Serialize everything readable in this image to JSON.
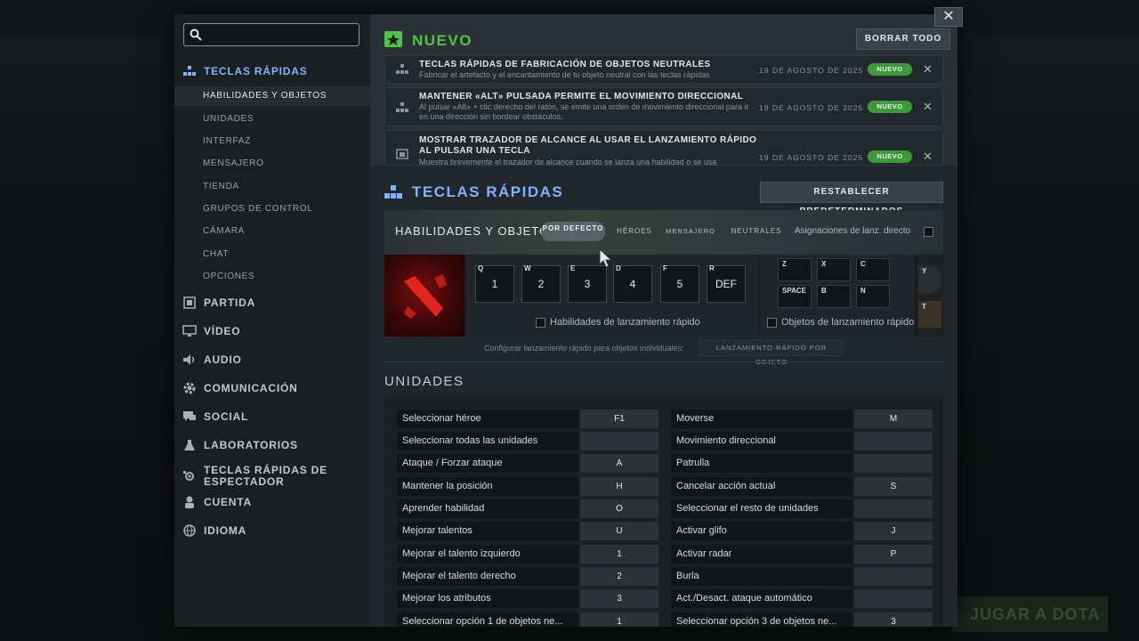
{
  "background": {
    "play_button": "JUGAR A DOTA"
  },
  "sidebar": {
    "search_placeholder": "",
    "categories": [
      {
        "label": "Teclas rápidas",
        "icon": "hotkeys-icon",
        "active": true
      },
      {
        "label": "Partida",
        "icon": "game-icon"
      },
      {
        "label": "Vídeo",
        "icon": "monitor-icon"
      },
      {
        "label": "Audio",
        "icon": "speaker-icon"
      },
      {
        "label": "Comunicación",
        "icon": "gear-icon"
      },
      {
        "label": "Social",
        "icon": "chat-icon"
      },
      {
        "label": "Laboratorios",
        "icon": "flask-icon"
      },
      {
        "label": "Teclas rápidas de espectador",
        "icon": "spectator-icon"
      },
      {
        "label": "Cuenta",
        "icon": "user-icon"
      },
      {
        "label": "Idioma",
        "icon": "globe-icon"
      }
    ],
    "subitems": [
      "Habilidades y objetos",
      "Unidades",
      "Interfaz",
      "Mensajero",
      "Tienda",
      "Grupos de control",
      "Cámara",
      "Chat",
      "Opciones"
    ]
  },
  "new_section": {
    "title": "NUEVO",
    "clear_all": "BORRAR TODO",
    "items": [
      {
        "title": "Teclas rápidas de fabricación de objetos neutrales",
        "desc": "Fabricar el artefacto y el encantamiento de tu objeto neutral con las teclas rápidas",
        "date": "19 de agosto de 2025",
        "badge": "NUEVO"
      },
      {
        "title": "Mantener «Alt» pulsada permite el movimiento direccional",
        "desc": "Al pulsar «Alt» + clic derecho del ratón, se emite una orden de movimiento direccional para ir en una dirección sin bordear obstáculos.",
        "date": "19 de agosto de 2025",
        "badge": "NUEVO"
      },
      {
        "title": "Mostrar trazador de alcance al usar el lanzamiento rápido al pulsar una tecla",
        "desc": "Muestra brevemente el trazador de alcance cuando se lanza una habilidad o se usa",
        "date": "19 de agosto de 2025",
        "badge": "NUEVO"
      }
    ]
  },
  "hotkeys_section": {
    "title": "TECLAS RÁPIDAS",
    "reset_button": "RESTABLECER PREDETERMINADOS",
    "tab_label": "Habilidades y objetos",
    "tabs": [
      "POR DEFECTO",
      "HÉROES",
      "MENSAJERO",
      "NEUTRALES"
    ],
    "direct_cast_label": "Asignaciones de lanz. directo",
    "ability_keys": [
      {
        "key": "Q",
        "value": "1"
      },
      {
        "key": "W",
        "value": "2"
      },
      {
        "key": "E",
        "value": "3"
      },
      {
        "key": "D",
        "value": "4"
      },
      {
        "key": "F",
        "value": "5"
      },
      {
        "key": "R",
        "value": "DEF"
      }
    ],
    "item_keys": [
      "Z",
      "X",
      "C",
      "SPACE",
      "B",
      "N"
    ],
    "extra_keys": [
      "Y",
      "T"
    ],
    "quick_cast_abilities": "Habilidades de lanzamiento rápido",
    "quick_cast_items": "Objetos de lanzamiento rápido",
    "configure_label": "Configurar lanzamiento rápido para objetos individuales:",
    "per_item_button": "LANZAMIENTO RÁPIDO POR OBJETO"
  },
  "units_section": {
    "title": "UNIDADES",
    "left": [
      {
        "label": "Seleccionar héroe",
        "key": "F1"
      },
      {
        "label": "Seleccionar todas las unidades",
        "key": ""
      },
      {
        "label": "Ataque / Forzar ataque",
        "key": "A"
      },
      {
        "label": "Mantener la posición",
        "key": "H"
      },
      {
        "label": "Aprender habilidad",
        "key": "O"
      },
      {
        "label": "Mejorar talentos",
        "key": "U"
      },
      {
        "label": "Mejorar el talento izquierdo",
        "key": "1"
      },
      {
        "label": "Mejorar el talento derecho",
        "key": "2"
      },
      {
        "label": "Mejorar los atributos",
        "key": "3"
      },
      {
        "label": "Seleccionar opción 1 de objetos ne...",
        "key": "1"
      }
    ],
    "right": [
      {
        "label": "Moverse",
        "key": "M"
      },
      {
        "label": "Movimiento direccional",
        "key": ""
      },
      {
        "label": "Patrulla",
        "key": ""
      },
      {
        "label": "Cancelar acción actual",
        "key": "S"
      },
      {
        "label": "Seleccionar el resto de unidades",
        "key": ""
      },
      {
        "label": "Activar glifo",
        "key": "J"
      },
      {
        "label": "Activar radar",
        "key": "P"
      },
      {
        "label": "Burla",
        "key": ""
      },
      {
        "label": "Act./Desact. ataque automático",
        "key": ""
      },
      {
        "label": "Seleccionar opción 3 de objetos ne...",
        "key": "3"
      }
    ]
  },
  "close_button": "✕",
  "colors": {
    "accent_blue": "#7fb2ff",
    "badge_green": "#3d9a3a",
    "new_green": "#4fc24a"
  }
}
